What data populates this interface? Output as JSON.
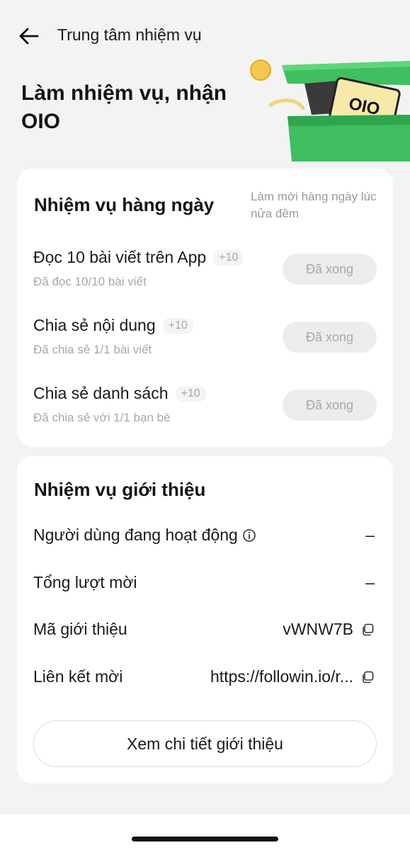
{
  "header": {
    "title": "Trung tâm nhiệm vụ",
    "back_icon": "arrow-left-icon"
  },
  "hero": {
    "title": "Làm nhiệm vụ, nhận OIO",
    "gift_label": "OIO",
    "colors": {
      "box": "#3fbf5f",
      "ticket": "#f7e9a8",
      "coin": "#f2c94c"
    }
  },
  "daily": {
    "title": "Nhiệm vụ hàng ngày",
    "refresh_note": "Làm mới hàng ngày lúc nửa đêm",
    "tasks": [
      {
        "title": "Đọc 10 bài viết trên App",
        "points": "+10",
        "subtitle": "Đã đọc 10/10 bài viết",
        "button": "Đã xong"
      },
      {
        "title": "Chia sẻ nội dung",
        "points": "+10",
        "subtitle": "Đã chia sẻ 1/1 bài viết",
        "button": "Đã xong"
      },
      {
        "title": "Chia sẻ danh sách",
        "points": "+10",
        "subtitle": "Đã chia sẻ với 1/1 bạn bè",
        "button": "Đã xong"
      }
    ]
  },
  "referral": {
    "title": "Nhiệm vụ giới thiệu",
    "rows": [
      {
        "label": "Người dùng đang hoạt động",
        "value": "–"
      },
      {
        "label": "Tổng lượt mời",
        "value": "–"
      },
      {
        "label": "Mã giới thiệu",
        "value": "vWNW7B"
      },
      {
        "label": "Liên kết mời",
        "value": "https://followin.io/r..."
      }
    ],
    "detail_button": "Xem chi tiết giới thiệu"
  }
}
